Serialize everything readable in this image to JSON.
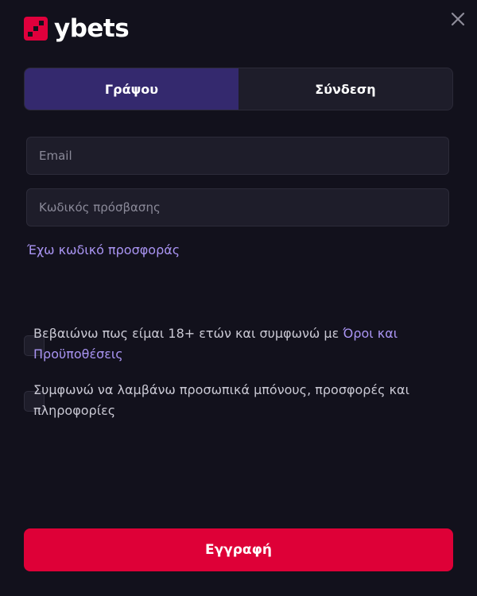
{
  "brand": {
    "name": "ybets",
    "accent_color": "#e0003c"
  },
  "header": {
    "close_icon": "close-icon"
  },
  "tabs": [
    {
      "label": "Γράψου",
      "active": true
    },
    {
      "label": "Σύνδεση",
      "active": false
    }
  ],
  "form": {
    "email_placeholder": "Email",
    "email_value": "",
    "password_placeholder": "Κωδικός πρόσβασης",
    "password_value": "",
    "promo_link": "Έχω κωδικό προσφοράς"
  },
  "consents": [
    {
      "text": "Βεβαιώνω πως είμαι 18+ ετών και συμφωνώ με ",
      "link": "Όροι και Προϋποθέσεις",
      "checked": false
    },
    {
      "text": "Συμφωνώ να λαμβάνω προσωπικά μπόνους, προσφορές και πληροφορίες",
      "checked": false
    }
  ],
  "submit_label": "Εγγραφή",
  "colors": {
    "background": "#12111c",
    "active_tab": "#34296e",
    "link": "#a994f2",
    "submit": "#de0037"
  }
}
